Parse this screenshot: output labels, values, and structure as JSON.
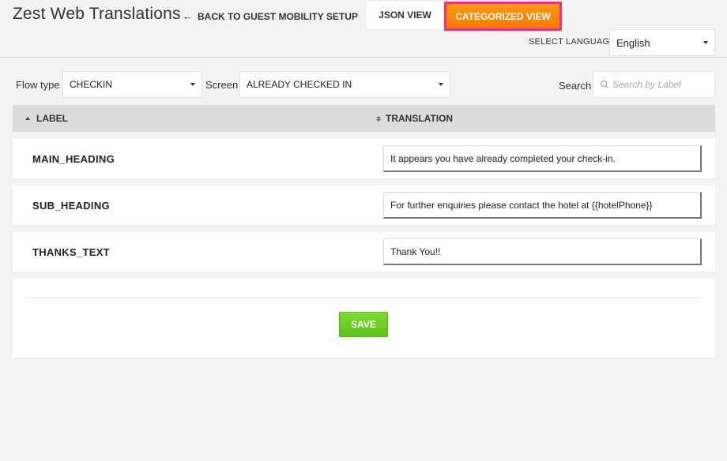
{
  "header": {
    "title": "Zest Web Translations",
    "back_arrow": "←",
    "back_link": "BACK TO GUEST MOBILITY SETUP",
    "tabs": [
      {
        "label": "JSON VIEW",
        "active": false
      },
      {
        "label": "CATEGORIZED VIEW",
        "active": true
      }
    ],
    "select_language_label": "SELECT LANGUAGE",
    "language_value": "English"
  },
  "filters": {
    "flow_type_label": "Flow type",
    "flow_type_value": "CHECKIN",
    "screen_label": "Screen",
    "screen_value": "ALREADY CHECKED IN",
    "search_label": "Search",
    "search_placeholder": "Search by Label",
    "search_value": ""
  },
  "table": {
    "columns": [
      "LABEL",
      "TRANSLATION"
    ],
    "sort": {
      "LABEL": "ascending"
    },
    "rows": [
      {
        "label": "MAIN_HEADING",
        "translation": "It appears you have already completed your check-in."
      },
      {
        "label": "SUB_HEADING",
        "translation": "For further enquiries please contact the hotel at {{hotelPhone}}"
      },
      {
        "label": "THANKS_TEXT",
        "translation": "Thank You!!"
      }
    ]
  },
  "save": {
    "label": "SAVE"
  },
  "icons": {
    "back": "arrow-left-icon",
    "dropdown": "caret-down-icon",
    "search": "search-icon",
    "sort_asc": "sort-ascending-icon",
    "sort_both": "sort-icon"
  },
  "colors": {
    "accent_orange": "#ff8a0a",
    "highlight_border": "#f0327a",
    "save_green": "#6ccf26",
    "header_bar": "#dcdcdc",
    "background": "#f3f3f3"
  }
}
